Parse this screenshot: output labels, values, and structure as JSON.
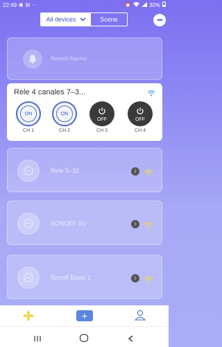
{
  "status": {
    "time": "22:49",
    "battery": "30%"
  },
  "header": {
    "tab_devices": "All devices",
    "tab_scene": "Scene"
  },
  "alarm": {
    "label": "Recent Alarms"
  },
  "active_device": {
    "title": "Rele 4 canales 7–3...",
    "channels": [
      {
        "label": "CH 1",
        "state": "ON"
      },
      {
        "label": "CH 2",
        "state": "ON"
      },
      {
        "label": "CH 3",
        "state": "OFF"
      },
      {
        "label": "CH 4",
        "state": "OFF"
      }
    ]
  },
  "devices": [
    {
      "name": "Rele 5–32"
    },
    {
      "name": "SONOFF SV"
    },
    {
      "name": "Sonoff Basic 2"
    }
  ],
  "colors": {
    "accent": "#5b86e0",
    "on_ring": "#4b6bcc",
    "wifi_yellow": "#f2d84a",
    "wifi_blue": "#4aa3e8"
  }
}
